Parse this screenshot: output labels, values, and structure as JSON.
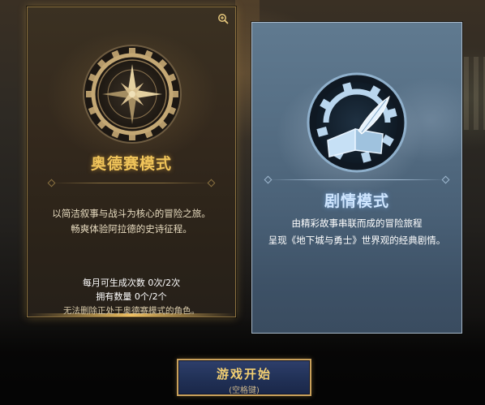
{
  "modes": {
    "odyssey": {
      "title": "奥德赛模式",
      "desc_line1": "以简洁叙事与战斗为核心的冒险之旅。",
      "desc_line2": "畅爽体验阿拉德的史诗征程。",
      "stat_monthly": "每月可生成次数 0次/2次",
      "stat_owned": "拥有数量 0个/2个",
      "warning": "无法删除正处于奥德赛模式的角色。",
      "icon": "compass-gear-icon",
      "zoom_icon": "zoom-icon",
      "accent": "#f0c45a"
    },
    "story": {
      "title": "剧情模式",
      "desc_line1": "由精彩故事串联而成的冒险旅程",
      "desc_line2": "呈现《地下城与勇士》世界观的经典剧情。",
      "icon": "book-quill-gear-icon",
      "accent": "#cfe6ff"
    }
  },
  "start_button": {
    "label": "游戏开始",
    "hint": "(空格键)"
  }
}
